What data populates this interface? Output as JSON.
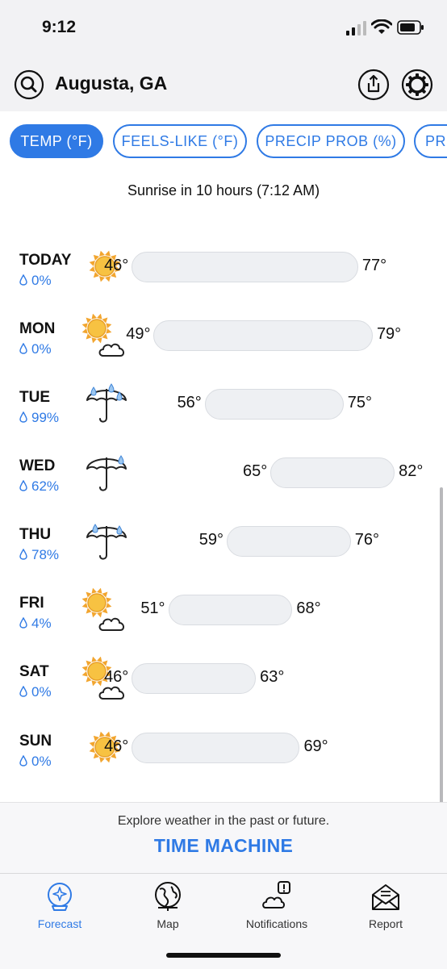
{
  "status": {
    "time": "9:12"
  },
  "header": {
    "city": "Augusta, GA"
  },
  "tabs": [
    {
      "label": "TEMP (°F)",
      "active": true
    },
    {
      "label": "FEELS-LIKE (°F)",
      "active": false
    },
    {
      "label": "PRECIP PROB (%)",
      "active": false
    },
    {
      "label": "PR",
      "active": false
    }
  ],
  "sunrise": "Sunrise in 10 hours (7:12 AM)",
  "days": [
    {
      "name": "TODAY",
      "precip": "0%",
      "low": "46°",
      "high": "77°",
      "icon": "sun-icon"
    },
    {
      "name": "MON",
      "precip": "0%",
      "low": "49°",
      "high": "79°",
      "icon": "partly-cloudy-icon"
    },
    {
      "name": "TUE",
      "precip": "99%",
      "low": "56°",
      "high": "75°",
      "icon": "umbrella-rain-icon"
    },
    {
      "name": "WED",
      "precip": "62%",
      "low": "65°",
      "high": "82°",
      "icon": "umbrella-rain-icon"
    },
    {
      "name": "THU",
      "precip": "78%",
      "low": "59°",
      "high": "76°",
      "icon": "umbrella-rain-icon"
    },
    {
      "name": "FRI",
      "precip": "4%",
      "low": "51°",
      "high": "68°",
      "icon": "partly-cloudy-icon"
    },
    {
      "name": "SAT",
      "precip": "0%",
      "low": "46°",
      "high": "63°",
      "icon": "partly-cloudy-icon"
    },
    {
      "name": "SUN",
      "precip": "0%",
      "low": "46°",
      "high": "69°",
      "icon": "sun-icon"
    }
  ],
  "footer": {
    "explore": "Explore weather in the past or future.",
    "time_machine": "TIME MACHINE"
  },
  "nav": {
    "forecast": "Forecast",
    "map": "Map",
    "notifications": "Notifications",
    "report": "Report"
  },
  "colors": {
    "accent": "#2f7ae5",
    "sun": "#f2b73a",
    "bar": "#eef0f3"
  }
}
